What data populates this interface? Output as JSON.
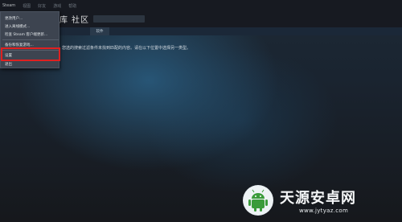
{
  "menubar": {
    "items": [
      "Steam",
      "视图",
      "好友",
      "游戏",
      "帮助"
    ]
  },
  "nav": {
    "title_part1": "库",
    "title_part2": "社区"
  },
  "subtab": {
    "label": "软件"
  },
  "main": {
    "message": "您选的搜索过滤条件未找到匹配的内容。请在以下位置中选择另一类型。"
  },
  "dropdown": {
    "items": [
      "更改用户...",
      "进入离线模式...",
      "检查 Steam 客户端更新...",
      "备份和恢复游戏...",
      "设置",
      "退出"
    ],
    "highlighted_index": 4
  },
  "colors": {
    "highlight_border": "#e02020",
    "menu_bg": "#3d4450",
    "header_bg": "#171a21"
  },
  "watermark": {
    "title": "天源安卓网",
    "url": "www.jytyaz.com",
    "logo_icon": "android-robot-icon"
  }
}
